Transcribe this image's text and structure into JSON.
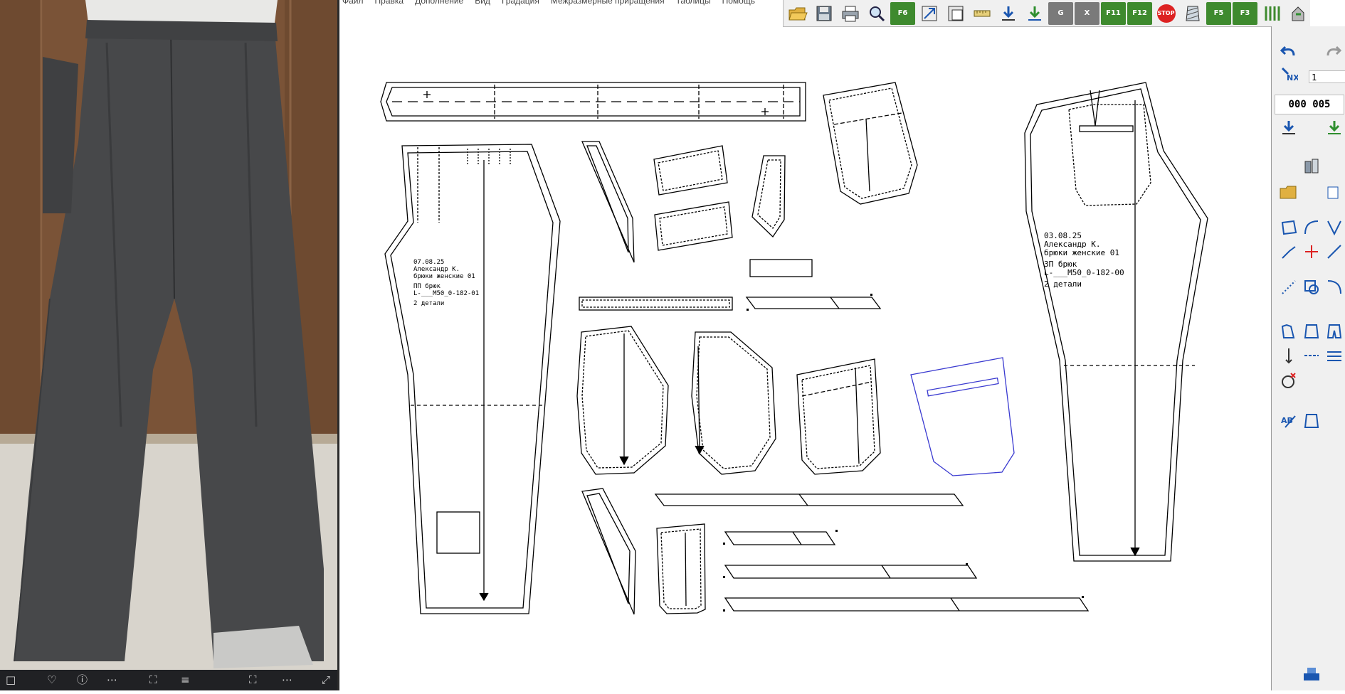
{
  "menu": {
    "items": [
      "Файл",
      "Правка",
      "Дополнение",
      "Вид",
      "Градация",
      "Межразмерные приращения",
      "Таблицы",
      "Помощь"
    ]
  },
  "toolbar": {
    "buttons": [
      {
        "icon": "open-folder-icon"
      },
      {
        "icon": "save-icon"
      },
      {
        "icon": "print-icon"
      },
      {
        "icon": "zoom-icon"
      },
      {
        "icon": "f6-icon",
        "label": "F6"
      },
      {
        "icon": "transform-icon"
      },
      {
        "icon": "piece-icon"
      },
      {
        "icon": "measure-icon"
      },
      {
        "icon": "download-icon"
      },
      {
        "icon": "download-green-icon"
      },
      {
        "icon": "table-g-icon",
        "label": "G"
      },
      {
        "icon": "table-x-icon",
        "label": "X"
      },
      {
        "icon": "f11-icon",
        "label": "F11"
      },
      {
        "icon": "f12-icon",
        "label": "F12"
      },
      {
        "icon": "stop-icon",
        "label": "STOP"
      },
      {
        "icon": "hatch-icon"
      },
      {
        "icon": "f5-icon",
        "label": "F5"
      },
      {
        "icon": "f3-icon",
        "label": "F3"
      },
      {
        "icon": "stripes-icon"
      },
      {
        "icon": "exit-icon"
      }
    ]
  },
  "palette": {
    "value_field": "1",
    "counter": "000 005"
  },
  "photo_viewer": {
    "bottom_icons": [
      "□",
      "♡",
      "ⓘ",
      "⋯",
      "⛶",
      "≡",
      "⛶",
      "⋯",
      "⤢"
    ]
  },
  "pattern": {
    "front_piece": {
      "date": "03.08.25",
      "author": "Александр К.",
      "model": "брюки женские  01",
      "piece": "ЗП брюк",
      "code": "L-___M50_0-182-00",
      "count": "2 детали"
    },
    "back_piece": {
      "date": "07.08.25",
      "author": "Александр К.",
      "model": "брюки женские  01",
      "piece": "ПП брюк",
      "code": "L-___M50_0-182-01",
      "count": "2 детали"
    }
  }
}
